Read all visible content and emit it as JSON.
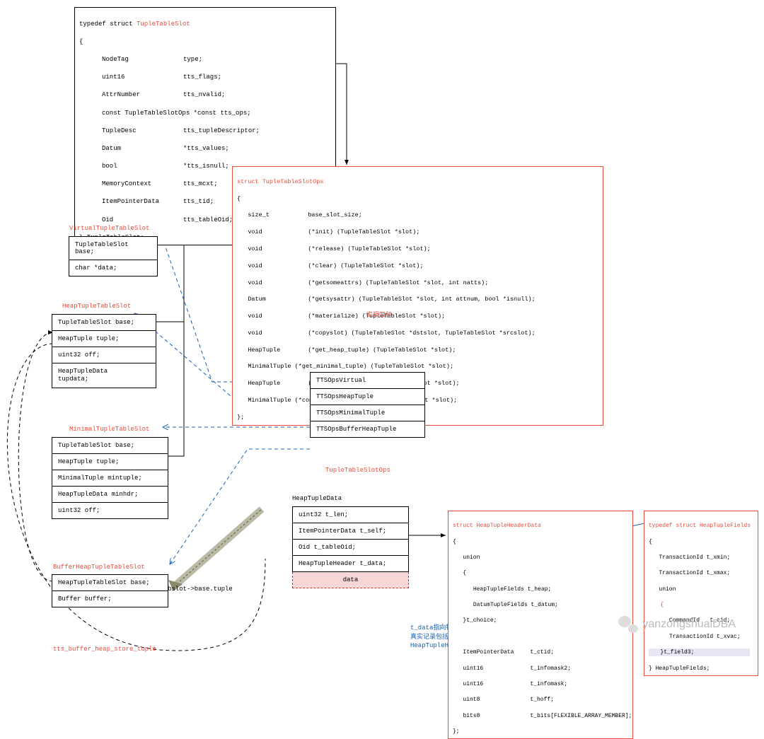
{
  "structs": {
    "tupleTableSlot": {
      "header_prefix": "typedef struct ",
      "header_name": "TupleTableSlot",
      "open": "{",
      "fields": [
        {
          "type": "NodeTag",
          "name": "type;"
        },
        {
          "type": "uint16",
          "name": "tts_flags;"
        },
        {
          "type": "AttrNumber",
          "name": "tts_nvalid;"
        },
        {
          "type": "const TupleTableSlotOps",
          "name": "*const tts_ops;"
        },
        {
          "type": "TupleDesc",
          "name": "tts_tupleDescriptor;"
        },
        {
          "type": "Datum",
          "name": "*tts_values;"
        },
        {
          "type": "bool",
          "name": "*tts_isnull;"
        },
        {
          "type": "MemoryContext",
          "name": "tts_mcxt;"
        },
        {
          "type": "ItemPointerData",
          "name": "tts_tid;"
        },
        {
          "type": "Oid",
          "name": "tts_tableOid;"
        }
      ],
      "close": "} TupleTableSlot;"
    },
    "tupleTableSlotOps": {
      "header": "struct TupleTableSlotOps",
      "open": "{",
      "fields": [
        {
          "type": "size_t",
          "name": "base_slot_size;"
        },
        {
          "type": "void",
          "name": "(*init) (TupleTableSlot *slot);"
        },
        {
          "type": "void",
          "name": "(*release) (TupleTableSlot *slot);"
        },
        {
          "type": "void",
          "name": "(*clear) (TupleTableSlot *slot);"
        },
        {
          "type": "void",
          "name": "(*getsomeattrs) (TupleTableSlot *slot, int natts);"
        },
        {
          "type": "Datum",
          "name": "(*getsysattr) (TupleTableSlot *slot, int attnum, bool *isnull);"
        },
        {
          "type": "void",
          "name": "(*materialize) (TupleTableSlot *slot);"
        },
        {
          "type": "void",
          "name": "(*copyslot) (TupleTableSlot *dstslot, TupleTableSlot *srcslot);"
        },
        {
          "type": "HeapTuple",
          "name": "(*get_heap_tuple) (TupleTableSlot *slot);"
        },
        {
          "type": "MinimalTuple",
          "name": "(*get_minimal_tuple) (TupleTableSlot *slot);"
        },
        {
          "type": "HeapTuple",
          "name": "(*copy_heap_tuple) (TupleTableSlot *slot);"
        },
        {
          "type": "MinimalTuple",
          "name": "(*copy_minimal_tuple) (TupleTableSlot *slot);"
        }
      ],
      "close": "};"
    },
    "heapTupleHeaderData": {
      "header": "struct HeapTupleHeaderData",
      "open": "{",
      "union_label": "union",
      "union_open": "{",
      "union_fields": [
        "HeapTupleFields t_heap;",
        "DatumTupleFields t_datum;"
      ],
      "union_close": "}t_choice;",
      "fields": [
        {
          "type": "ItemPointerData",
          "name": "t_ctid;"
        },
        {
          "type": "uint16",
          "name": "t_infomask2;"
        },
        {
          "type": "uint16",
          "name": "t_infomask;"
        },
        {
          "type": "uint8",
          "name": "t_hoff;"
        },
        {
          "type": "bits8",
          "name": "t_bits[FLEXIBLE_ARRAY_MEMBER];"
        }
      ],
      "close": "};"
    },
    "heapTupleFields": {
      "header": "typedef struct HeapTupleFields",
      "open": "{",
      "f1": "TransactionId t_xmin;",
      "f2": "TransactionId t_xmax;",
      "union_label": "union",
      "union_open": "{",
      "uf1": "CommandId   t_cid;",
      "uf2": "TransactionId t_xvac;",
      "union_close": "}t_field3;",
      "close": "} HeapTupleFields;"
    }
  },
  "slots": {
    "virtual": {
      "title": "VirtualTupleTableSlot",
      "rows": [
        "TupleTableSlot base;",
        "char *data;"
      ]
    },
    "heap": {
      "title": "HeapTupleTableSlot",
      "rows": [
        "TupleTableSlot base;",
        "HeapTuple  tuple;",
        "uint32 off;",
        "HeapTupleData tupdata;"
      ]
    },
    "minimal": {
      "title": "MinimalTupleTableSlot",
      "rows": [
        "TupleTableSlot base;",
        "HeapTuple  tuple;",
        "MinimalTuple mintuple;",
        "HeapTupleData minhdr;",
        "uint32 off;"
      ]
    },
    "bufferHeap": {
      "title": "BufferHeapTupleTableSlot",
      "rows": [
        "HeapTupleTableSlot base;",
        "Buffer buffer;"
      ]
    }
  },
  "ops": {
    "note": "实现四种",
    "rows": [
      "TTSOpsVirtual",
      "TTSOpsHeapTuple",
      "TTSOpsMinimalTuple",
      "TTSOpsBufferHeapTuple"
    ],
    "label": "TupleTableSlotOps"
  },
  "heapTupleData": {
    "title": "HeapTupleData",
    "rows": [
      "uint32 t_len;",
      "ItemPointerData t_self;",
      "Oid t_tableOid;",
      "HeapTupleHeader t_data;"
    ],
    "data_row": "data"
  },
  "labels": {
    "bslot": "bslot->base.tuple",
    "tts_store": "tts_buffer_heap_store_tuple",
    "tdata_note_l1": "t_data指向物理页中记录",
    "tdata_note_l2": "真实记录包括：",
    "tdata_note_l3": "HeapTupleHeader + data",
    "watermark": "yanzongshuaiDBA"
  }
}
